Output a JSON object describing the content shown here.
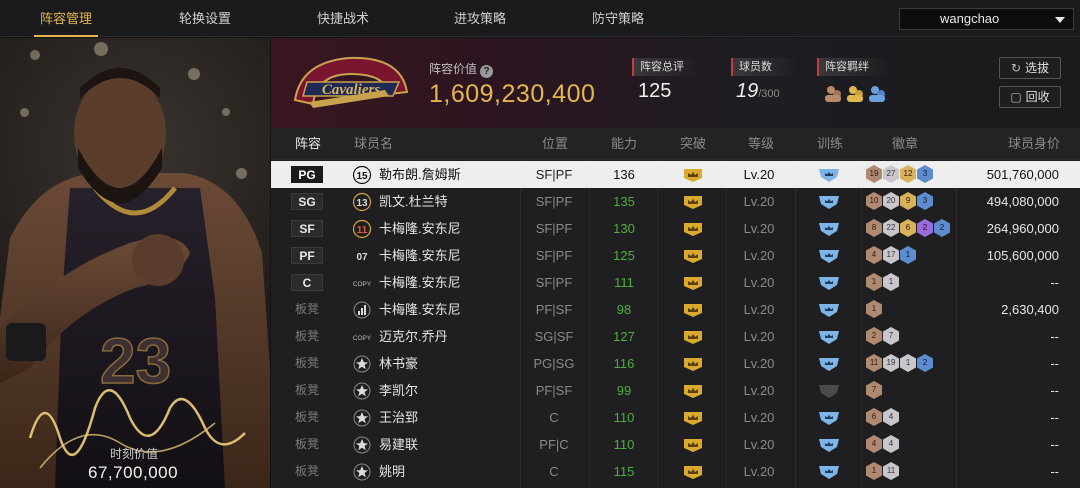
{
  "nav": {
    "tabs": [
      "阵容管理",
      "轮换设置",
      "快捷战术",
      "进攻策略",
      "防守策略"
    ],
    "active_tab": 0,
    "username": "wangchao"
  },
  "card": {
    "jersey_number": "23",
    "value_label": "时刻价值",
    "value": "67,700,000"
  },
  "header": {
    "team_logo": "cleveland-cavaliers-logo",
    "lineup_value_label": "阵容价值",
    "lineup_value": "1,609,230,400",
    "overall_label": "阵容总评",
    "overall_value": "125",
    "player_count_label": "球员数",
    "player_count_value": "19",
    "player_count_max": "/300",
    "bond_label": "阵容羁绊",
    "select_button": "选拔",
    "recycle_button": "回收"
  },
  "table": {
    "columns": [
      "阵容",
      "球员名",
      "位置",
      "能力",
      "突破",
      "等级",
      "训练",
      "徽章",
      "球员身价"
    ],
    "rows": [
      {
        "slot": "PG",
        "bench": false,
        "selected": true,
        "jersey": "15",
        "name": "勒布朗.詹姆斯",
        "position": "SF|PF",
        "ability": "136",
        "level": "Lv.20",
        "train": "blue",
        "badges": [
          {
            "t": "bronze",
            "v": "19"
          },
          {
            "t": "silver",
            "v": "27"
          },
          {
            "t": "gold",
            "v": "12"
          },
          {
            "t": "blue",
            "v": "3"
          }
        ],
        "worth": "501,760,000"
      },
      {
        "slot": "SG",
        "bench": false,
        "selected": false,
        "jersey": "13",
        "name": "凯文.杜兰特",
        "position": "SF|PF",
        "ability": "135",
        "level": "Lv.20",
        "train": "blue",
        "badges": [
          {
            "t": "bronze",
            "v": "10"
          },
          {
            "t": "silver",
            "v": "20"
          },
          {
            "t": "gold",
            "v": "9"
          },
          {
            "t": "blue",
            "v": "3"
          }
        ],
        "worth": "494,080,000"
      },
      {
        "slot": "SF",
        "bench": false,
        "selected": false,
        "jersey": "11",
        "name": "卡梅隆.安东尼",
        "position": "SF|PF",
        "ability": "130",
        "level": "Lv.20",
        "train": "blue",
        "badges": [
          {
            "t": "bronze",
            "v": "8"
          },
          {
            "t": "silver",
            "v": "22"
          },
          {
            "t": "gold",
            "v": "6"
          },
          {
            "t": "purple",
            "v": "2"
          },
          {
            "t": "blue",
            "v": "2"
          }
        ],
        "worth": "264,960,000"
      },
      {
        "slot": "PF",
        "bench": false,
        "selected": false,
        "jersey": "07",
        "name": "卡梅隆.安东尼",
        "position": "SF|PF",
        "ability": "125",
        "level": "Lv.20",
        "train": "blue",
        "badges": [
          {
            "t": "bronze",
            "v": "4"
          },
          {
            "t": "silver",
            "v": "17"
          },
          {
            "t": "blue",
            "v": "1"
          }
        ],
        "worth": "105,600,000"
      },
      {
        "slot": "C",
        "bench": false,
        "selected": false,
        "jersey": "COPY",
        "name": "卡梅隆.安东尼",
        "position": "SF|PF",
        "ability": "111",
        "level": "Lv.20",
        "train": "blue",
        "badges": [
          {
            "t": "bronze",
            "v": "1"
          },
          {
            "t": "silver",
            "v": "1"
          }
        ],
        "worth": "--"
      },
      {
        "slot": "板凳",
        "bench": true,
        "selected": false,
        "jersey": "bars",
        "name": "卡梅隆.安东尼",
        "position": "PF|SF",
        "ability": "98",
        "level": "Lv.20",
        "train": "blue",
        "badges": [
          {
            "t": "bronze",
            "v": "1"
          }
        ],
        "worth": "2,630,400"
      },
      {
        "slot": "板凳",
        "bench": true,
        "selected": false,
        "jersey": "COPY",
        "name": "迈克尔.乔丹",
        "position": "SG|SF",
        "ability": "127",
        "level": "Lv.20",
        "train": "blue",
        "badges": [
          {
            "t": "bronze",
            "v": "2"
          },
          {
            "t": "silver",
            "v": "7"
          }
        ],
        "worth": "--"
      },
      {
        "slot": "板凳",
        "bench": true,
        "selected": false,
        "jersey": "star",
        "name": "林书豪",
        "position": "PG|SG",
        "ability": "116",
        "level": "Lv.20",
        "train": "blue",
        "badges": [
          {
            "t": "bronze",
            "v": "11"
          },
          {
            "t": "silver",
            "v": "19"
          },
          {
            "t": "silver",
            "v": "1"
          },
          {
            "t": "blue",
            "v": "2"
          }
        ],
        "worth": "--"
      },
      {
        "slot": "板凳",
        "bench": true,
        "selected": false,
        "jersey": "star",
        "name": "李凯尔",
        "position": "PF|SF",
        "ability": "99",
        "level": "Lv.20",
        "train": "gray",
        "badges": [
          {
            "t": "bronze",
            "v": "7"
          }
        ],
        "worth": "--"
      },
      {
        "slot": "板凳",
        "bench": true,
        "selected": false,
        "jersey": "star",
        "name": "王治郅",
        "position": "C",
        "ability": "110",
        "level": "Lv.20",
        "train": "blue",
        "badges": [
          {
            "t": "bronze",
            "v": "6"
          },
          {
            "t": "silver",
            "v": "4"
          }
        ],
        "worth": "--"
      },
      {
        "slot": "板凳",
        "bench": true,
        "selected": false,
        "jersey": "star",
        "name": "易建联",
        "position": "PF|C",
        "ability": "110",
        "level": "Lv.20",
        "train": "blue",
        "badges": [
          {
            "t": "bronze",
            "v": "4"
          },
          {
            "t": "silver",
            "v": "4"
          }
        ],
        "worth": "--"
      },
      {
        "slot": "板凳",
        "bench": true,
        "selected": false,
        "jersey": "star",
        "name": "姚明",
        "position": "C",
        "ability": "115",
        "level": "Lv.20",
        "train": "blue",
        "badges": [
          {
            "t": "bronze",
            "v": "1"
          },
          {
            "t": "silver",
            "v": "11"
          }
        ],
        "worth": "--"
      }
    ]
  },
  "colors": {
    "accent_gold": "#e3b54a",
    "ability_green": "#4fae3c",
    "stat_marker_red": "#c83b3b"
  }
}
